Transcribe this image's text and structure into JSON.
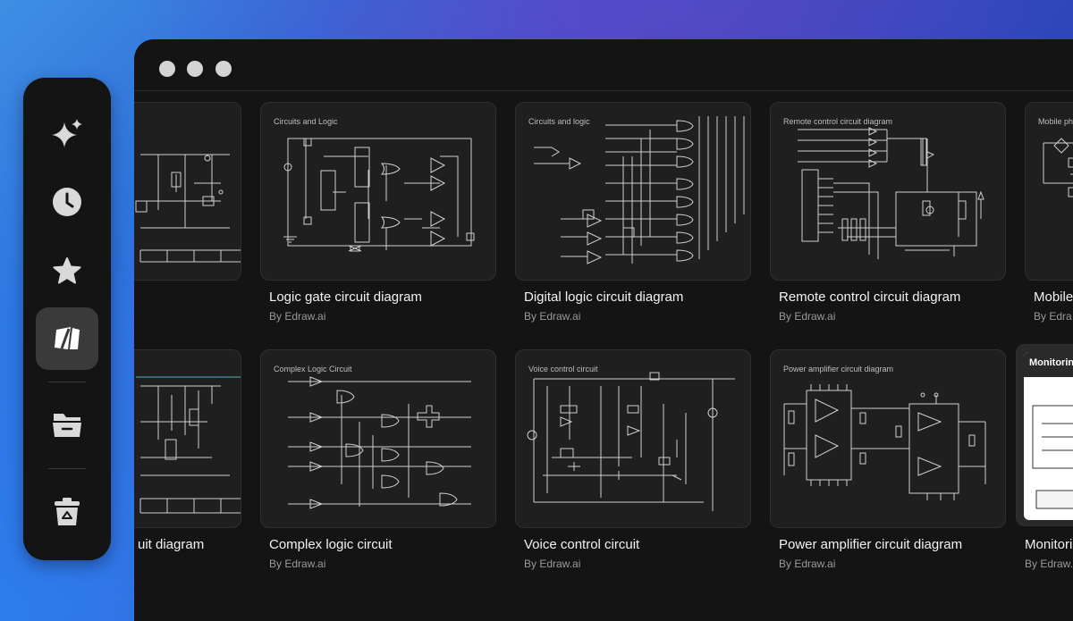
{
  "window": {
    "traffic_lights": [
      "close",
      "minimize",
      "maximize"
    ]
  },
  "sidebar": {
    "items": [
      {
        "name": "ai-sparkle-icon",
        "active": false
      },
      {
        "name": "recent-icon",
        "active": false
      },
      {
        "name": "favorites-icon",
        "active": false
      },
      {
        "name": "templates-icon",
        "active": true
      },
      {
        "name": "folder-icon",
        "active": false
      },
      {
        "name": "trash-icon",
        "active": false
      }
    ],
    "accent_color": "#7a57e8"
  },
  "cards_row1": [
    {
      "title": "",
      "author": "",
      "thumb_title": ""
    },
    {
      "title": "Logic gate circuit diagram",
      "author": "By Edraw.ai",
      "thumb_title": "Circuits and Logic"
    },
    {
      "title": "Digital logic circuit diagram",
      "author": "By Edraw.ai",
      "thumb_title": "Circuits and logic"
    },
    {
      "title": "Remote control circuit diagram",
      "author": "By Edraw.ai",
      "thumb_title": "Remote control circuit diagram"
    },
    {
      "title": "Mobile",
      "author": "By Edra",
      "thumb_title": "Mobile pho"
    }
  ],
  "cards_row2": [
    {
      "title": "uit diagram",
      "author": "",
      "thumb_title": ""
    },
    {
      "title": "Complex logic circuit",
      "author": "By Edraw.ai",
      "thumb_title": "Complex Logic Circuit"
    },
    {
      "title": "Voice control circuit",
      "author": "By Edraw.ai",
      "thumb_title": "Voice control circuit"
    },
    {
      "title": "Power amplifier circuit diagram",
      "author": "By Edraw.ai",
      "thumb_title": "Power amplifier circuit diagram"
    },
    {
      "title": "Monitoring",
      "author": "By Edraw.a",
      "thumb_title": "Monitoring"
    }
  ]
}
